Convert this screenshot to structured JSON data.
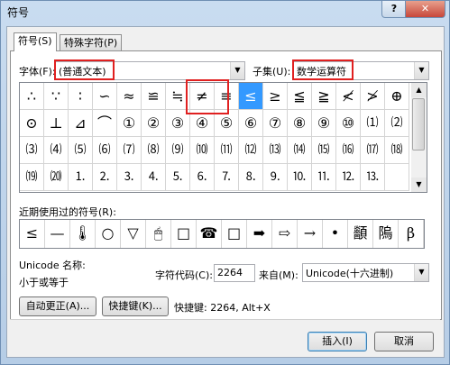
{
  "window": {
    "title": "符号",
    "help": "?",
    "close": "✕"
  },
  "tabs": [
    {
      "label": "符号(S)"
    },
    {
      "label": "特殊字符(P)"
    }
  ],
  "font": {
    "label": "字体(F):",
    "value": "(普通文本)"
  },
  "subset": {
    "label": "子集(U):",
    "value": "数学运算符"
  },
  "grid": {
    "rows": [
      [
        "∴",
        "∵",
        "∶",
        "∽",
        "≈",
        "≌",
        "≒",
        "≠",
        "≡",
        "≤",
        "≥",
        "≦",
        "≧",
        "≮",
        "≯",
        "⊕"
      ],
      [
        "⊙",
        "⊥",
        "⊿",
        "⌒",
        "①",
        "②",
        "③",
        "④",
        "⑤",
        "⑥",
        "⑦",
        "⑧",
        "⑨",
        "⑩",
        "⑴",
        "⑵"
      ],
      [
        "⑶",
        "⑷",
        "⑸",
        "⑹",
        "⑺",
        "⑻",
        "⑼",
        "⑽",
        "⑾",
        "⑿",
        "⒀",
        "⒁",
        "⒂",
        "⒃",
        "⒄",
        "⒅"
      ],
      [
        "⒆",
        "⒇",
        "⒈",
        "⒉",
        "⒊",
        "⒋",
        "⒌",
        "⒍",
        "⒎",
        "⒏",
        "⒐",
        "⒑",
        "⒒",
        "⒓",
        "⒔",
        ""
      ]
    ],
    "selected": "≤"
  },
  "recent": {
    "label": "近期使用过的符号(R):",
    "symbols": [
      "≤",
      "—",
      "🌡",
      "○",
      "▽",
      "🖱",
      "□",
      "☎",
      "□",
      "➡",
      "⇨",
      "→",
      "•",
      "顲",
      "隖",
      "β"
    ]
  },
  "unicode_name": {
    "label": "Unicode 名称:",
    "value": "小于或等于"
  },
  "char_code": {
    "label": "字符代码(C):",
    "value": "2264"
  },
  "from": {
    "label": "来自(M):",
    "value": "Unicode(十六进制)"
  },
  "buttons": {
    "autocorrect": "自动更正(A)...",
    "shortcut": "快捷键(K)...",
    "insert": "插入(I)",
    "cancel": "取消"
  },
  "shortcut_info": "快捷键: 2264, Alt+X",
  "colors": {
    "highlight": "#e02020",
    "selection": "#3399ff"
  }
}
